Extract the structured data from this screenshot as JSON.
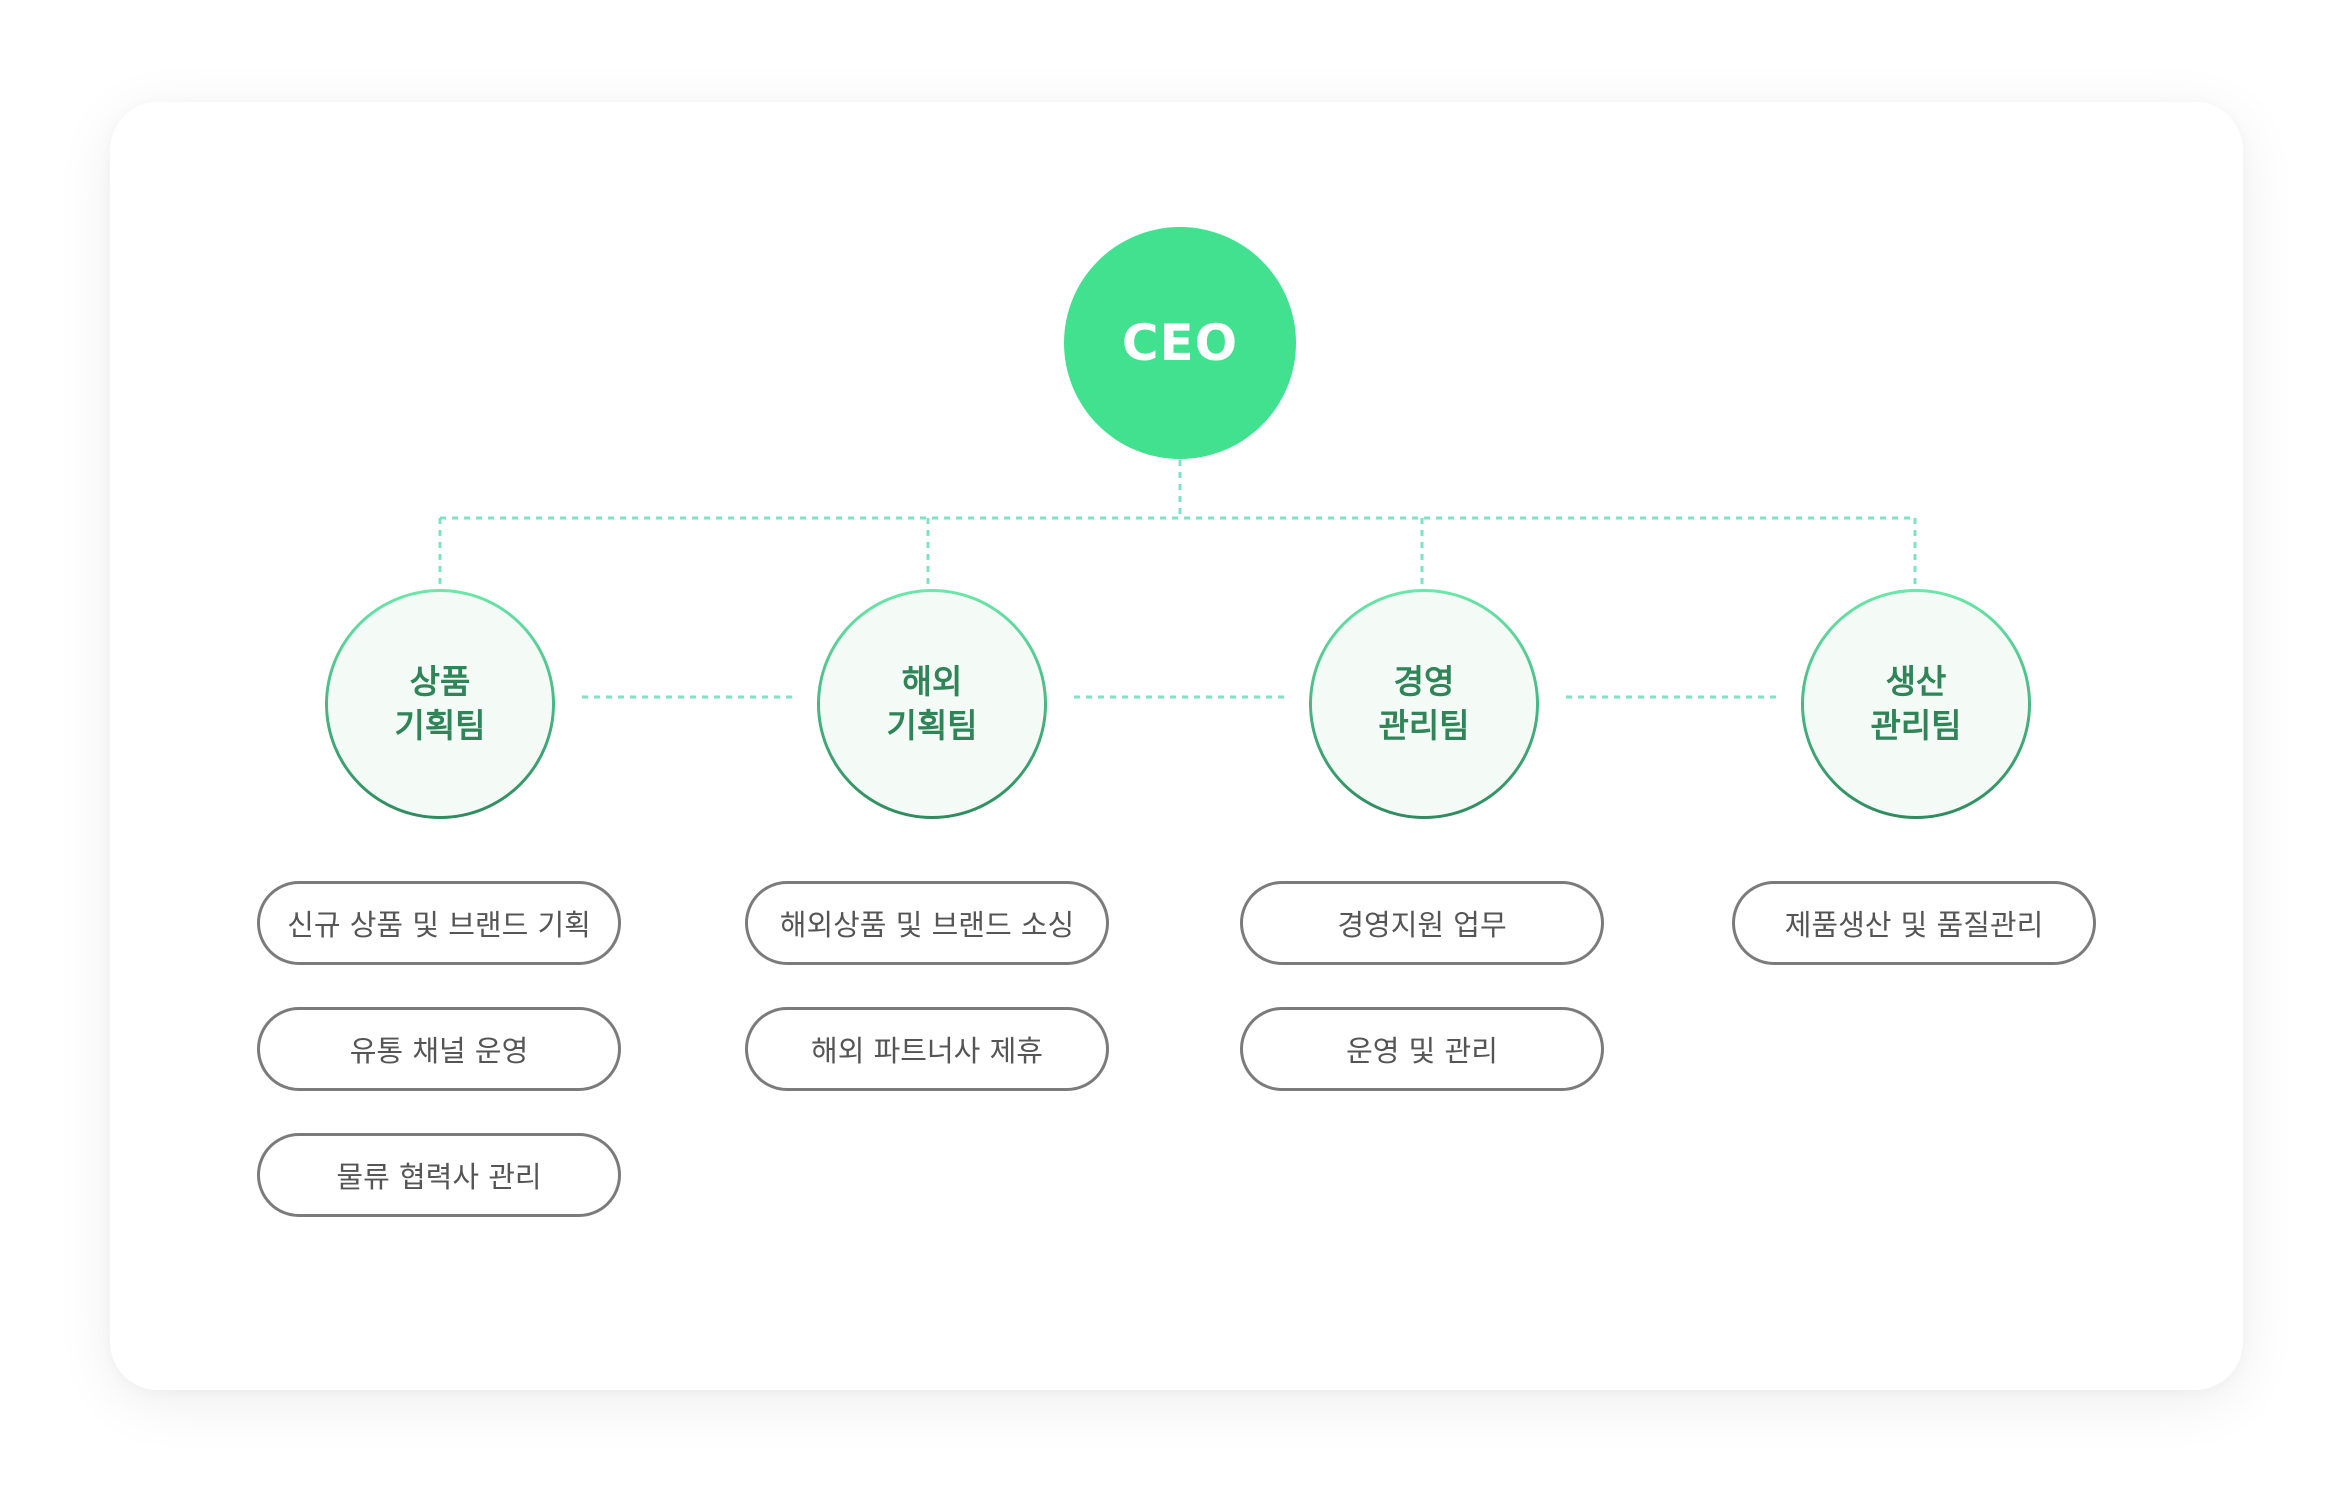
{
  "ceo": {
    "label": "CEO"
  },
  "teams": [
    {
      "label": "상품\n기획팀",
      "tasks": [
        "신규 상품 및 브랜드 기획",
        "유통 채널 운영",
        "물류 협력사 관리"
      ]
    },
    {
      "label": "해외\n기획팀",
      "tasks": [
        "해외상품 및 브랜드 소싱",
        "해외 파트너사 제휴"
      ]
    },
    {
      "label": "경영\n관리팀",
      "tasks": [
        "경영지원 업무",
        "운영 및 관리"
      ]
    },
    {
      "label": "생산\n관리팀",
      "tasks": [
        "제품생산 및 품질관리"
      ]
    }
  ],
  "colors": {
    "ceo_fill": "#42e190",
    "team_text": "#2f8458",
    "team_fill": "#f4fbf7",
    "connector": "#7ee3c4",
    "task_border": "#7b7b7b",
    "task_text": "#555555"
  }
}
